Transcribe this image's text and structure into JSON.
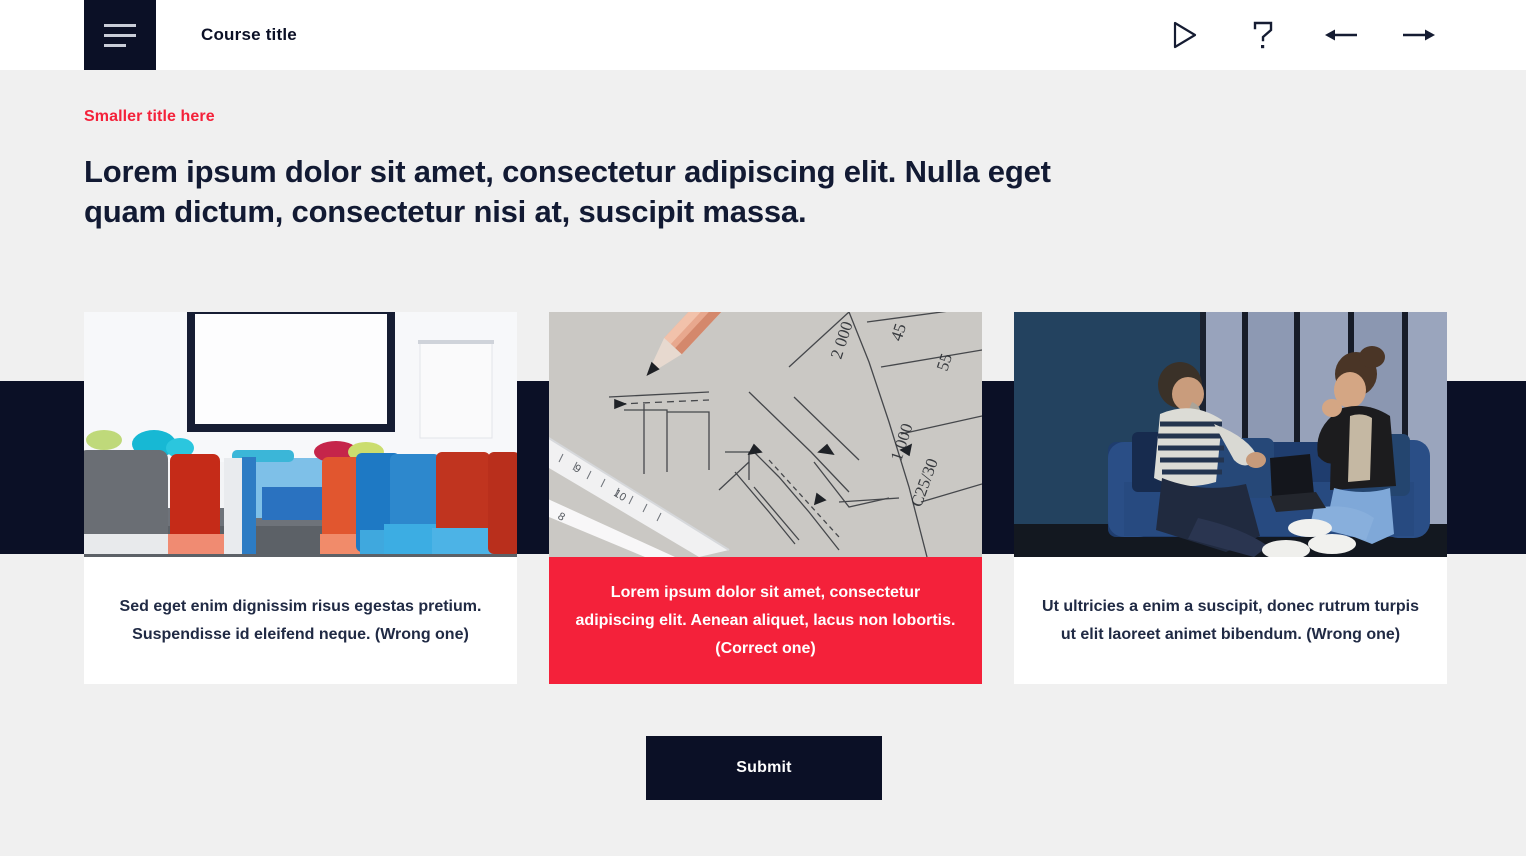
{
  "header": {
    "menu_icon": "hamburger-menu-icon",
    "course_title": "Course title",
    "actions": [
      {
        "icon": "play-icon",
        "label": "Play"
      },
      {
        "icon": "help-question-icon",
        "label": "Help"
      },
      {
        "icon": "arrow-left-icon",
        "label": "Previous"
      },
      {
        "icon": "arrow-right-icon",
        "label": "Next"
      }
    ]
  },
  "main": {
    "eyebrow": "Smaller title here",
    "headline": "Lorem ipsum dolor sit amet, consectetur adipiscing elit. Nulla eget quam dictum, consectetur nisi at, suscipit massa.",
    "options": [
      {
        "id": "option-1",
        "caption": "Sed eget enim dignissim risus egestas pretium. Suspendisse id eleifend neque. (Wrong one)",
        "selected": false,
        "image_alt": "classroom-with-colorful-chairs-and-whiteboard"
      },
      {
        "id": "option-2",
        "caption": "Lorem ipsum dolor sit amet, consectetur adipiscing elit. Aenean aliquet, lacus non lobortis. (Correct one)",
        "selected": true,
        "image_alt": "blueprint-drawing-with-pencil-and-ruler"
      },
      {
        "id": "option-3",
        "caption": "Ut ultricies a enim a suscipit, donec rutrum turpis ut elit laoreet animet bibendum. (Wrong one)",
        "selected": false,
        "image_alt": "two-people-talking-on-blue-sofa"
      }
    ],
    "submit_label": "Submit"
  },
  "colors": {
    "accent_red": "#F4213A",
    "navy": "#0B1026",
    "page_background": "#F0F0F0",
    "header_background": "#FFFFFF",
    "card_background": "#FFFFFF",
    "heading_text": "#121A33"
  }
}
